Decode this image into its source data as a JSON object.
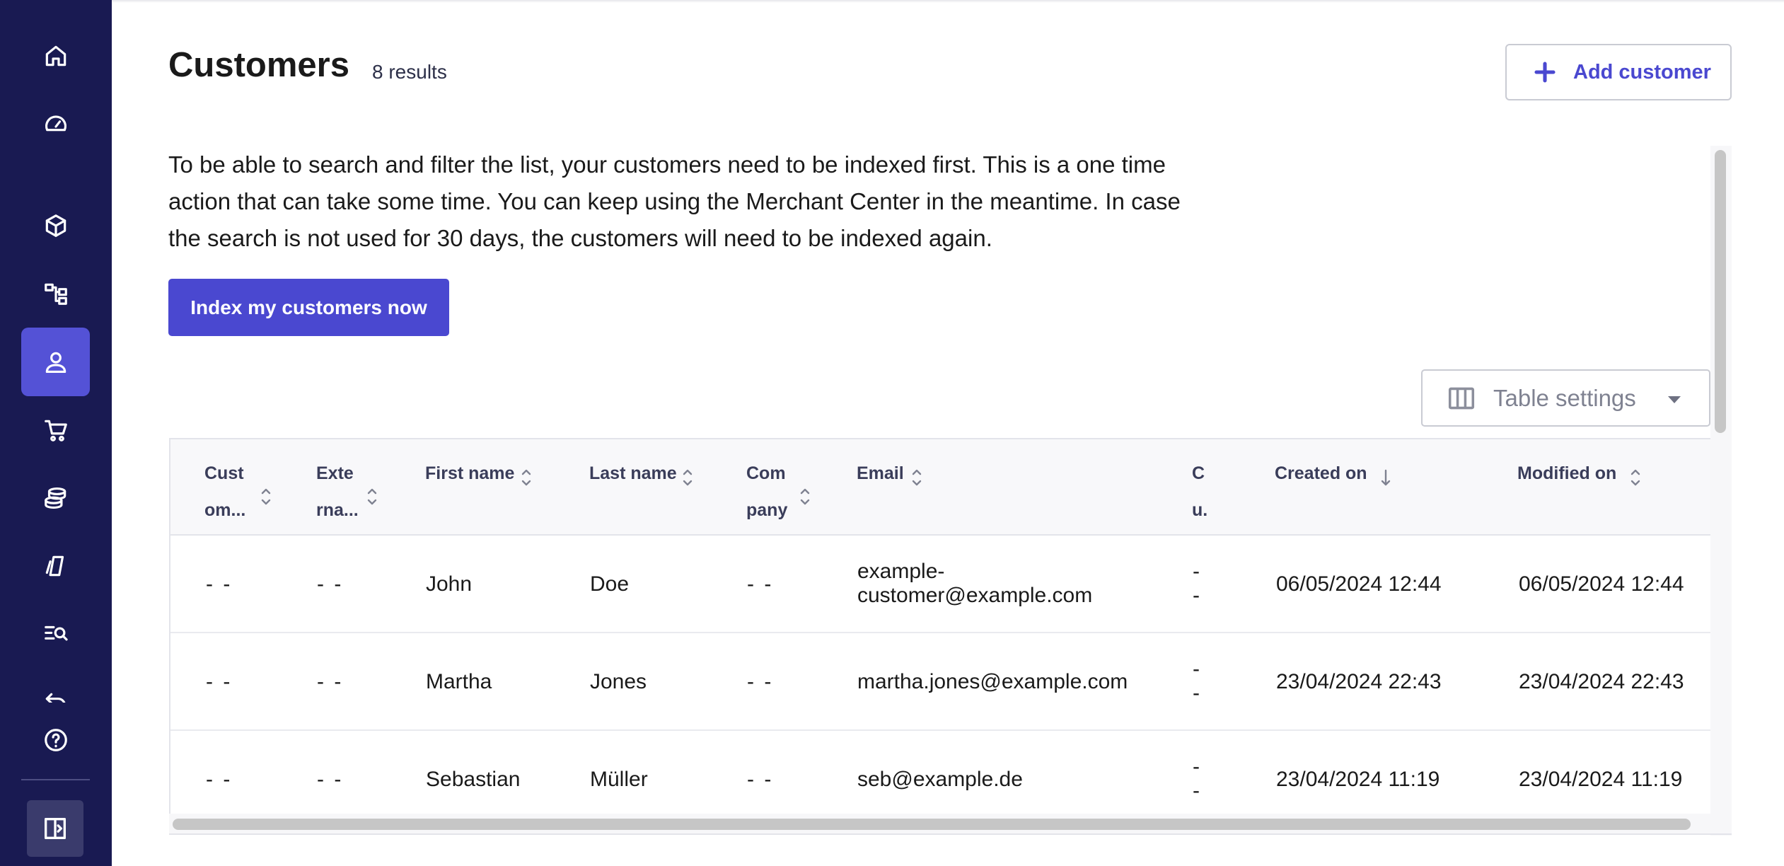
{
  "page": {
    "title": "Customers",
    "result_count": "8 results",
    "add_customer_label": "Add customer"
  },
  "info": {
    "line1": "To be able to search and filter the list, your customers need to be indexed first. This is a one time",
    "line2": "action that can take some time. You can keep using the Merchant Center in the meantime. In case",
    "line3": "the search is not used for 30 days, the customers will need to be indexed again.",
    "index_button_label": "Index my customers now"
  },
  "table_settings": {
    "label": "Table settings"
  },
  "sidebar": {
    "items": [
      {
        "icon": "home-icon",
        "active": false
      },
      {
        "icon": "dashboard-gauge-icon",
        "active": false
      },
      {
        "icon": "products-cube-icon",
        "active": false
      },
      {
        "icon": "categories-tree-icon",
        "active": false
      },
      {
        "icon": "customers-person-icon",
        "active": true
      },
      {
        "icon": "orders-cart-icon",
        "active": false
      },
      {
        "icon": "discounts-coins-icon",
        "active": false
      },
      {
        "icon": "content-icon",
        "active": false
      },
      {
        "icon": "search-list-icon",
        "active": false
      },
      {
        "icon": "undo-arrow-icon",
        "active": false
      },
      {
        "icon": "help-icon",
        "active": false
      }
    ],
    "collapse_icon": "collapse-sidebar-icon",
    "active_color": "#5452d6",
    "background_color": "#191a52"
  },
  "table": {
    "columns": [
      {
        "line1": "Cust",
        "line2": "om...",
        "sort": "both"
      },
      {
        "line1": "Exte",
        "line2": "rna...",
        "sort": "both"
      },
      {
        "line1": "First name",
        "line2": "",
        "sort": "both"
      },
      {
        "line1": "Last name",
        "line2": "",
        "sort": "both"
      },
      {
        "line1": "Com",
        "line2": "pany",
        "sort": "both"
      },
      {
        "line1": "Email",
        "line2": "",
        "sort": "both"
      },
      {
        "line1": "C",
        "line2": "u.",
        "sort": "none"
      },
      {
        "line1": "Created on",
        "line2": "",
        "sort": "desc"
      },
      {
        "line1": "Modified on",
        "line2": "",
        "sort": "both"
      }
    ],
    "rows": [
      {
        "customer_number": "- -",
        "external_id": "- -",
        "first_name": "John",
        "last_name": "Doe",
        "company": "- -",
        "email_line1": "example-",
        "email_line2": "customer@example.com",
        "cu_line1": "-",
        "cu_line2": "-",
        "created_on": "06/05/2024 12:44",
        "modified_on": "06/05/2024 12:44"
      },
      {
        "customer_number": "- -",
        "external_id": "- -",
        "first_name": "Martha",
        "last_name": "Jones",
        "company": "- -",
        "email_line1": "martha.jones@example.com",
        "email_line2": "",
        "cu_line1": "-",
        "cu_line2": "-",
        "created_on": "23/04/2024 22:43",
        "modified_on": "23/04/2024 22:43"
      },
      {
        "customer_number": "- -",
        "external_id": "- -",
        "first_name": "Sebastian",
        "last_name": "Müller",
        "company": "- -",
        "email_line1": "seb@example.de",
        "email_line2": "",
        "cu_line1": "-",
        "cu_line2": "-",
        "created_on": "23/04/2024 11:19",
        "modified_on": "23/04/2024 11:19"
      }
    ]
  },
  "colors": {
    "accent": "#4a48d0",
    "header_background": "#f8f8fa"
  }
}
